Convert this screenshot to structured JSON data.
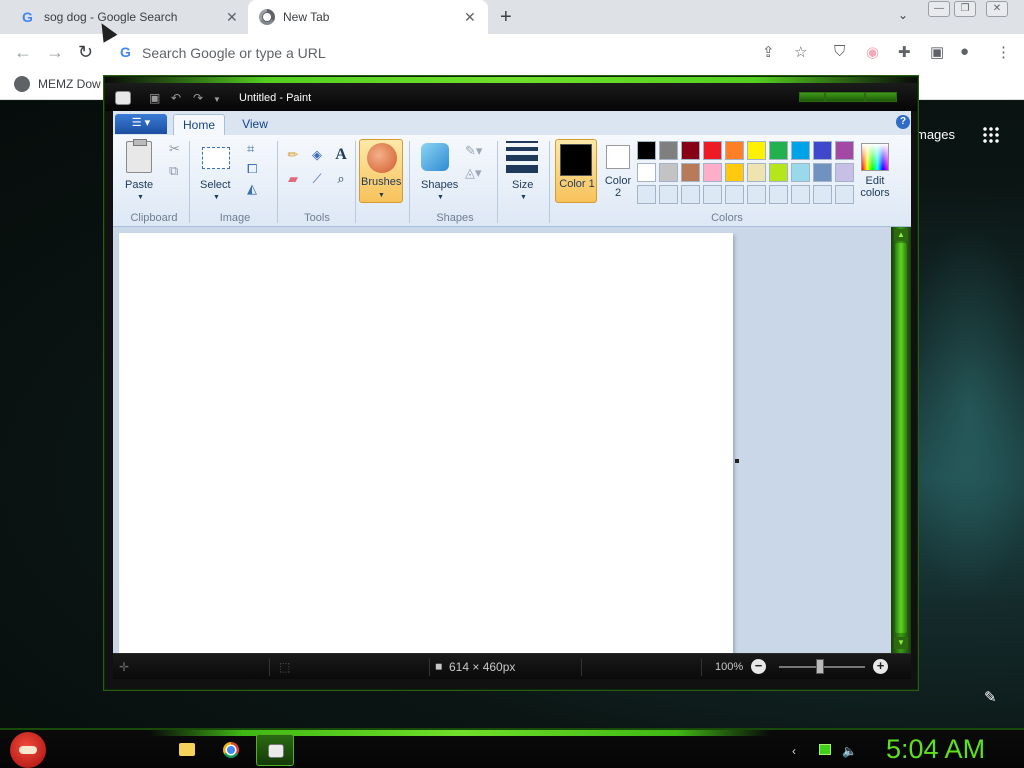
{
  "browser": {
    "tabs": [
      {
        "title": "sog dog - Google Search",
        "icon": "google-g-icon",
        "active": false
      },
      {
        "title": "New Tab",
        "icon": "chrome-icon",
        "active": true
      }
    ],
    "newtab_label": "+",
    "close_glyph": "✕",
    "omnibox_placeholder": "Search Google or type a URL",
    "bookmarks": [
      {
        "label": "MEMZ Dow"
      }
    ]
  },
  "newtab_page": {
    "images_link": "mages"
  },
  "paint": {
    "title": "Untitled - Paint",
    "tabs": [
      "Home",
      "View"
    ],
    "help_glyph": "?",
    "groups": {
      "clipboard": {
        "label": "Clipboard",
        "paste": "Paste"
      },
      "image": {
        "label": "Image",
        "select": "Select"
      },
      "tools": {
        "label": "Tools"
      },
      "brushes": "Brushes",
      "shapes": {
        "label": "Shapes",
        "button": "Shapes"
      },
      "size": "Size",
      "color1": "Color 1",
      "color2": "Color 2",
      "colors": {
        "label": "Colors",
        "edit": "Edit colors"
      }
    },
    "palette": [
      [
        "#000000",
        "#7f7f7f",
        "#880015",
        "#ed1c24",
        "#ff7f27",
        "#fff200",
        "#22b14c",
        "#00a2e8",
        "#3f48cc",
        "#a349a4"
      ],
      [
        "#ffffff",
        "#c3c3c3",
        "#b97a57",
        "#ffaec9",
        "#ffc90e",
        "#efe4b0",
        "#b5e61d",
        "#99d9ea",
        "#7092be",
        "#c8bfe7"
      ],
      [
        "#dde8f5",
        "#dde8f5",
        "#dde8f5",
        "#dde8f5",
        "#dde8f5",
        "#dde8f5",
        "#dde8f5",
        "#dde8f5",
        "#dde8f5",
        "#dde8f5"
      ]
    ],
    "color1": "#000000",
    "color2": "#ffffff",
    "status": {
      "canvas_size": "614 × 460px",
      "zoom": "100%"
    }
  },
  "taskbar": {
    "apps": [
      "file-explorer",
      "chrome",
      "paint"
    ],
    "clock": "5:04 AM"
  },
  "colors": {
    "accent_green": "#5fe01f",
    "ribbon_blue": "#dbe5f1"
  }
}
